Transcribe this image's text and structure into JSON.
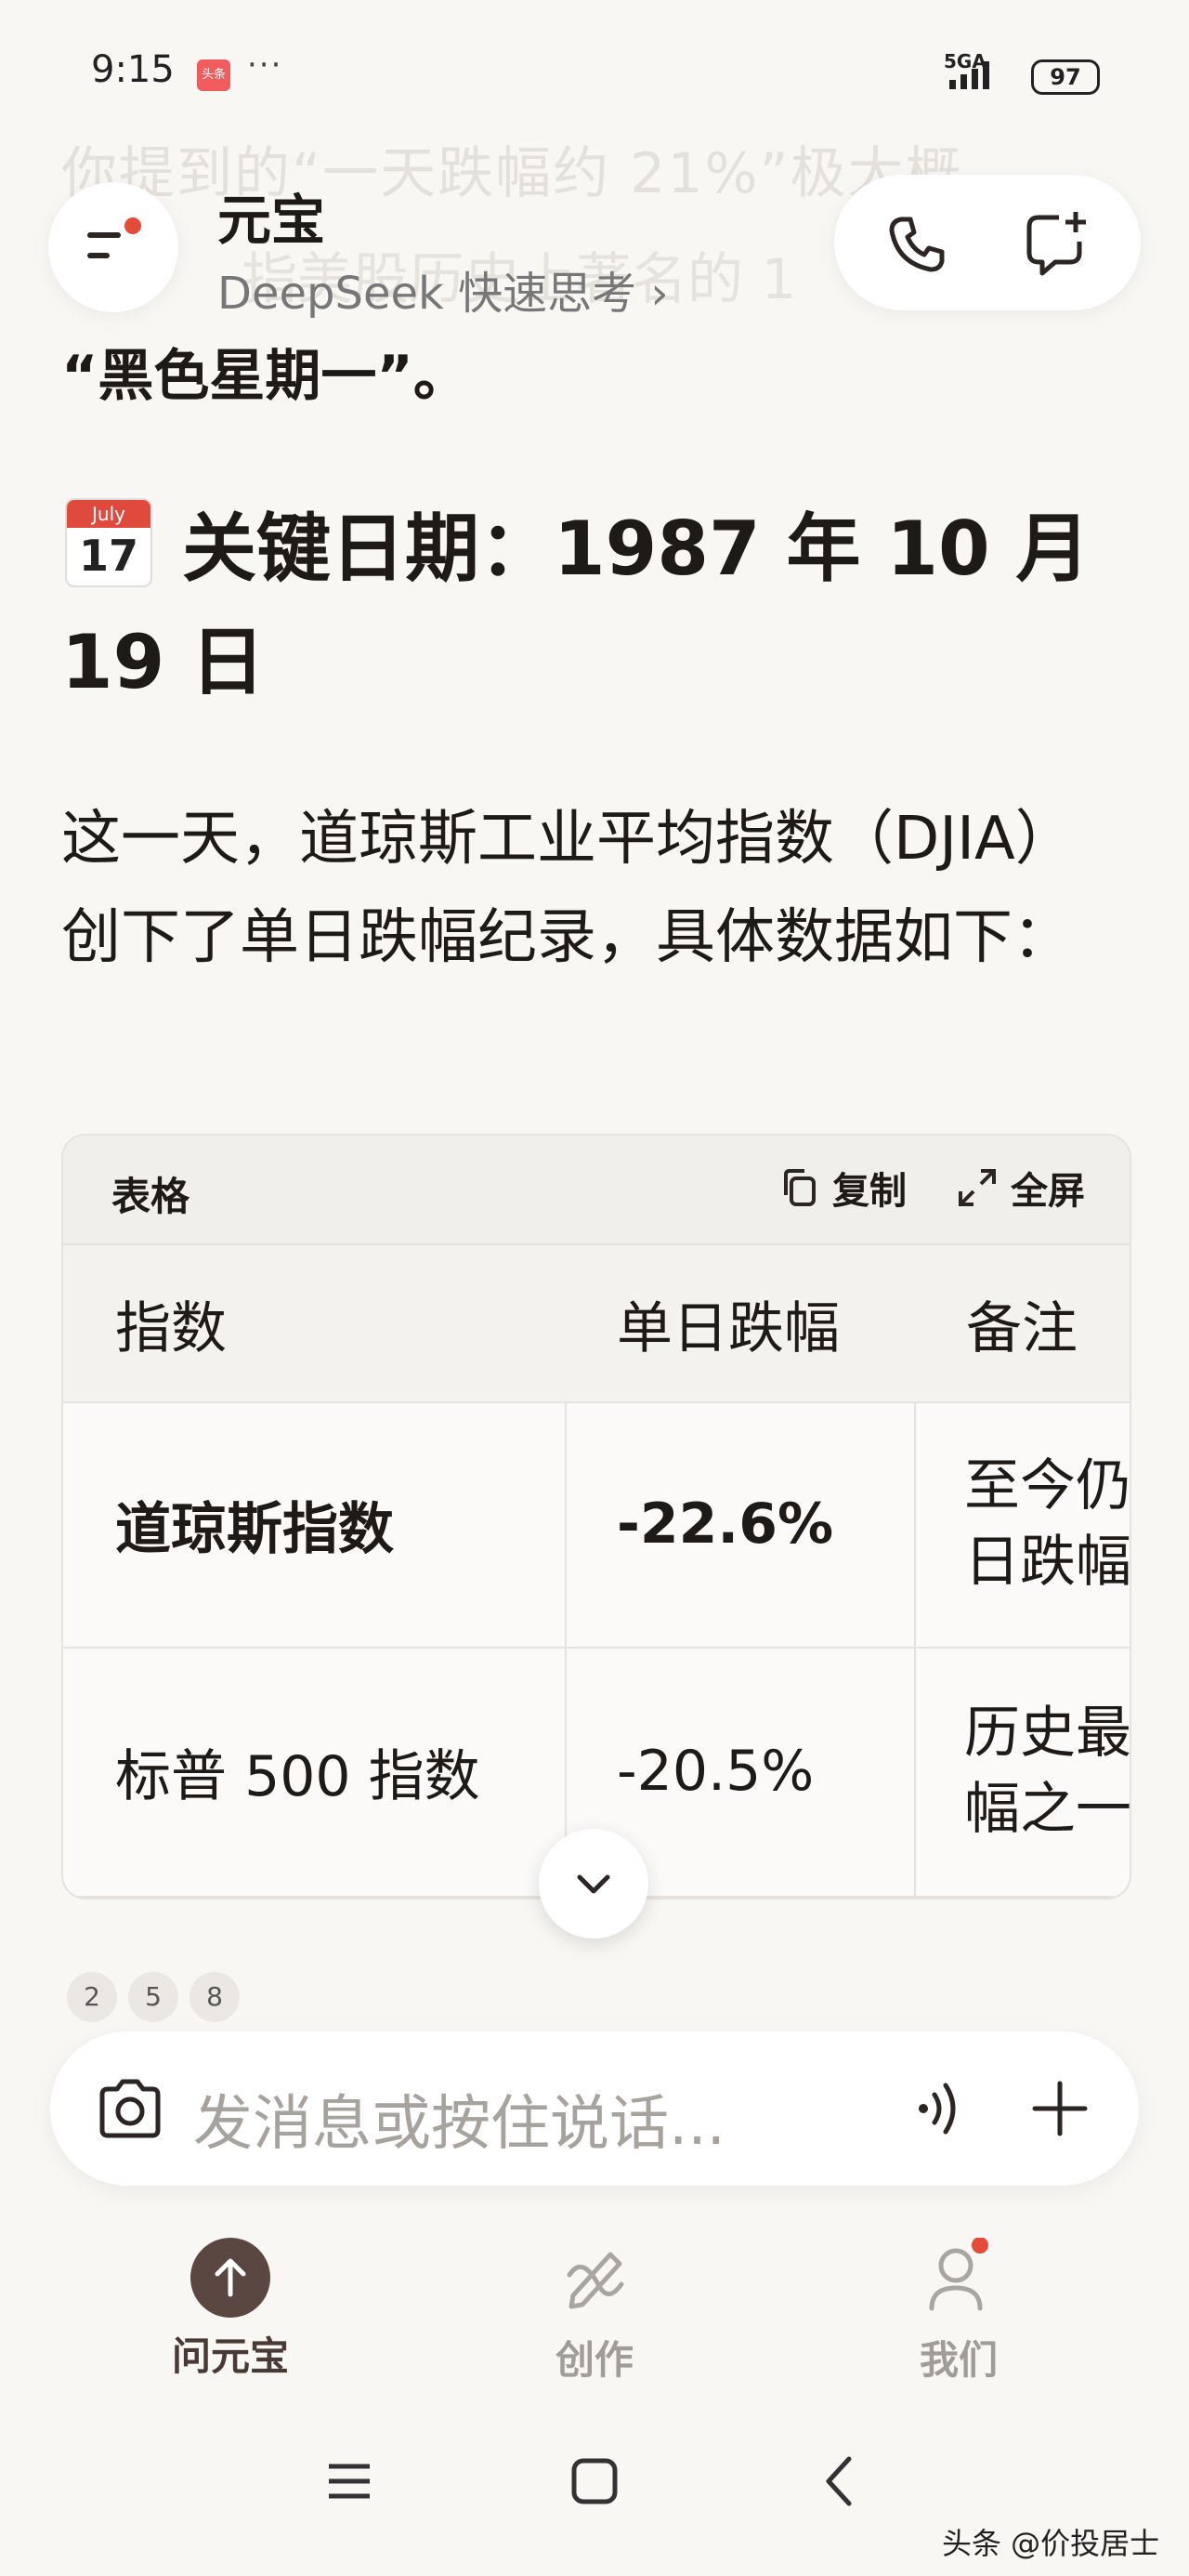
{
  "status_bar": {
    "time": "9:15",
    "badge": "头条",
    "more": "···",
    "network": "5GA",
    "battery": "97"
  },
  "faded_text": {
    "line1": "你提到的“一天跌幅约 21%”极大概",
    "line2": "指美股历史上著名的 1"
  },
  "header": {
    "title": "元宝",
    "subtitle": "DeepSeek 快速思考 ›"
  },
  "content": {
    "quote_line": "“黑色星期一”。",
    "calendar_month": "July",
    "calendar_day": "17",
    "heading": "关键日期：1987 年 10 月 19 日",
    "paragraph": "这一天，道琼斯工业平均指数（DJIA）创下了单日跌幅纪录，具体数据如下："
  },
  "table": {
    "label": "表格",
    "copy": "复制",
    "fullscreen": "全屏",
    "headers": [
      "指数",
      "单日跌幅",
      "备注"
    ],
    "rows": [
      {
        "index": "道琼斯指数",
        "drop": "-22.6%",
        "note1": "至今仍",
        "note2": "日跌幅"
      },
      {
        "index": "标普 500 指数",
        "drop": "-20.5%",
        "note1": "历史最",
        "note2": "幅之一"
      }
    ]
  },
  "references": [
    "2",
    "5",
    "8"
  ],
  "input": {
    "placeholder": "发消息或按住说话..."
  },
  "nav": {
    "ask": "问元宝",
    "create": "创作",
    "us": "我们"
  },
  "watermark": "头条 @价投居士",
  "colors": {
    "background": "#f8f7f4",
    "accent_dark": "#5a4742",
    "notification_red": "#e54b3a"
  }
}
